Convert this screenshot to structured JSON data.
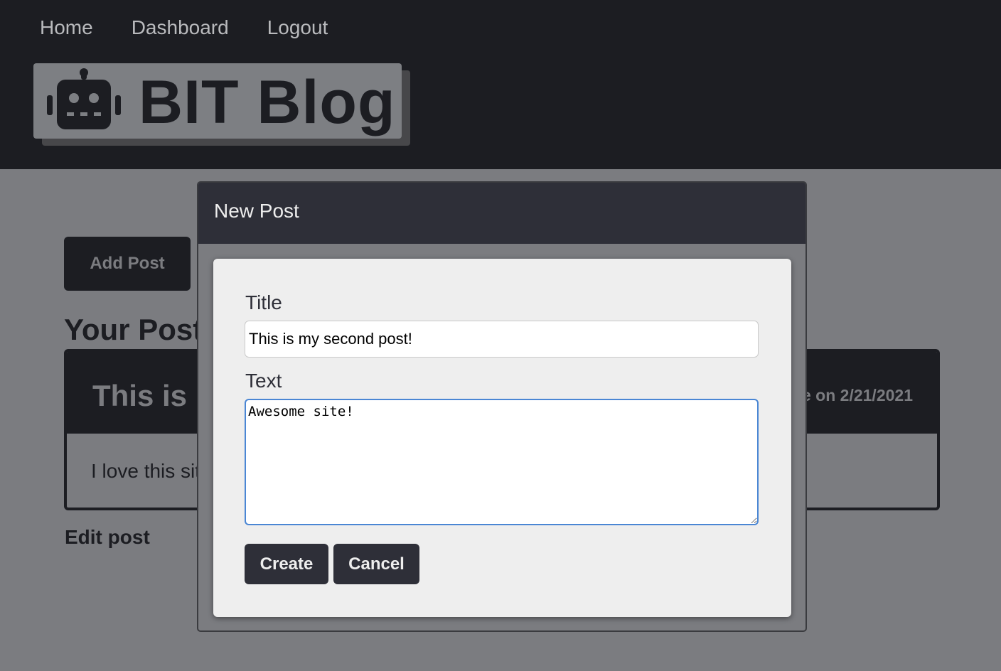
{
  "nav": {
    "home": "Home",
    "dashboard": "Dashboard",
    "logout": "Logout"
  },
  "logo": {
    "icon": "robot-icon",
    "text": "BIT Blog"
  },
  "dashboard": {
    "add_post_label": "Add Post",
    "section_title": "Your Posts",
    "post": {
      "title": "This is my first post!",
      "date": "Made on 2/21/2021",
      "body": "I love this site!"
    },
    "edit_link": "Edit post"
  },
  "modal": {
    "title": "New Post",
    "title_label": "Title",
    "title_value": "This is my second post!",
    "text_label": "Text",
    "text_value": "Awesome site!",
    "create_label": "Create",
    "cancel_label": "Cancel"
  },
  "colors": {
    "header_bg": "#1c1d22",
    "page_bg": "#7b7c80",
    "modal_header_bg": "#2e2f38",
    "panel_bg": "#eeeeee",
    "focus_border": "#4a86d4"
  }
}
